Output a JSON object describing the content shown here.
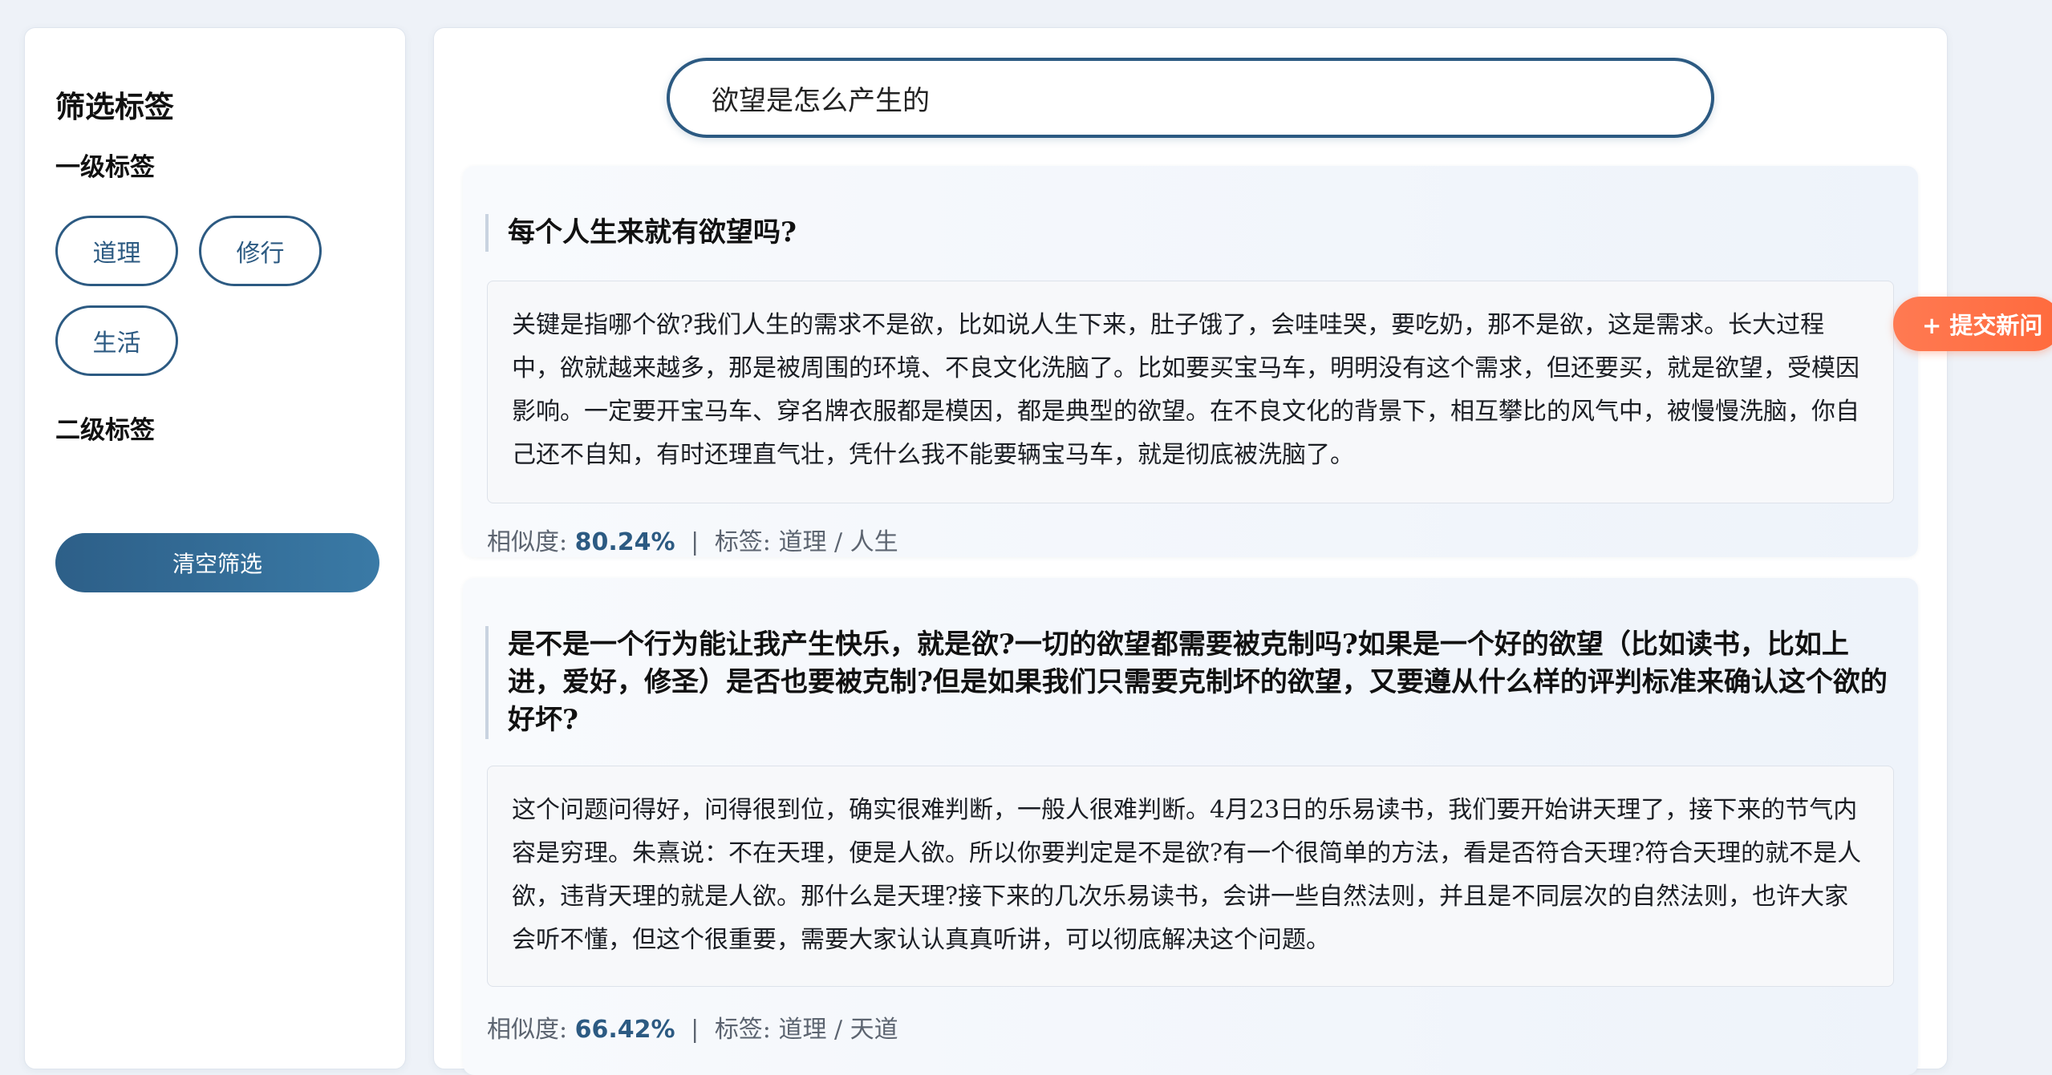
{
  "sidebar": {
    "title": "筛选标签",
    "level1_heading": "一级标签",
    "level1_tags": [
      "道理",
      "修行",
      "生活"
    ],
    "level2_heading": "二级标签",
    "clear_button": "清空筛选"
  },
  "search": {
    "value": "欲望是怎么产生的"
  },
  "results": [
    {
      "question": "每个人生来就有欲望吗?",
      "answer": "关键是指哪个欲?我们人生的需求不是欲，比如说人生下来，肚子饿了，会哇哇哭，要吃奶，那不是欲，这是需求。长大过程中，欲就越来越多，那是被周围的环境、不良文化洗脑了。比如要买宝马车，明明没有这个需求，但还要买，就是欲望，受模因影响。一定要开宝马车、穿名牌衣服都是模因，都是典型的欲望。在不良文化的背景下，相互攀比的风气中，被慢慢洗脑，你自己还不自知，有时还理直气壮，凭什么我不能要辆宝马车，就是彻底被洗脑了。",
      "similarity_label": "相似度:",
      "similarity": "80.24%",
      "tags_label": "标签:",
      "tags": "道理 / 人生"
    },
    {
      "question": "是不是一个行为能让我产生快乐，就是欲?一切的欲望都需要被克制吗?如果是一个好的欲望（比如读书，比如上进，爱好，修圣）是否也要被克制?但是如果我们只需要克制坏的欲望，又要遵从什么样的评判标准来确认这个欲的好坏?",
      "answer": "这个问题问得好，问得很到位，确实很难判断，一般人很难判断。4月23日的乐易读书，我们要开始讲天理了，接下来的节气内容是穷理。朱熹说：不在天理，便是人欲。所以你要判定是不是欲?有一个很简单的方法，看是否符合天理?符合天理的就不是人欲，违背天理的就是人欲。那什么是天理?接下来的几次乐易读书，会讲一些自然法则，并且是不同层次的自然法则，也许大家会听不懂，但这个很重要，需要大家认认真真听讲，可以彻底解决这个问题。",
      "similarity_label": "相似度:",
      "similarity": "66.42%",
      "tags_label": "标签:",
      "tags": "道理 / 天道"
    }
  ],
  "float_button": "+ 提交新问",
  "colors": {
    "primary": "#2c5a82",
    "accent": "#ff6a3d",
    "background": "#eef2f8"
  }
}
